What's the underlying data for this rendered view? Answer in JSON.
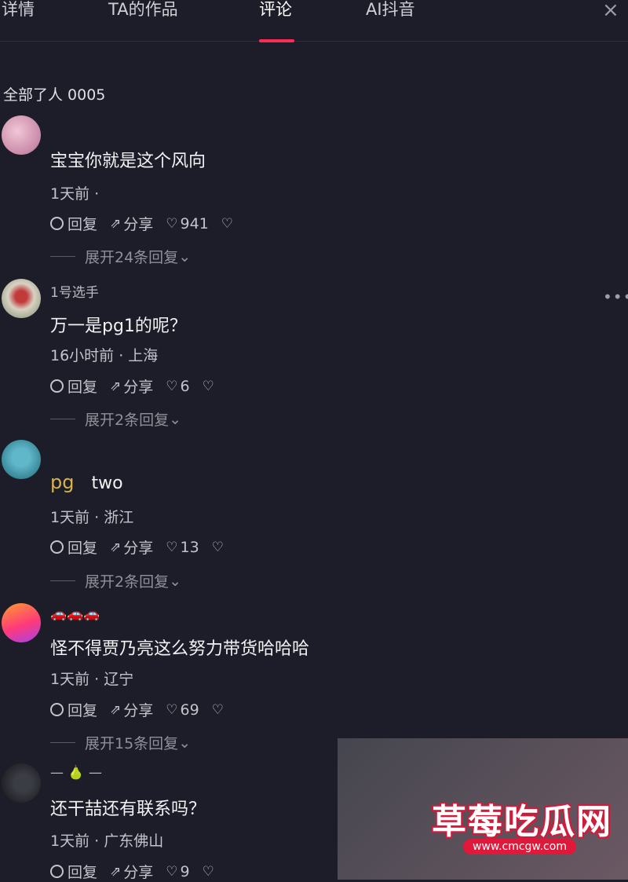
{
  "tabs": [
    "详情",
    "TA的作品",
    "评论",
    "AI抖音"
  ],
  "close_label": "×",
  "comment_count": "全部了人 0005",
  "actions": {
    "reply": "回复",
    "share": "分享"
  },
  "comments": [
    {
      "user": "",
      "text": "宝宝你就是这个风向",
      "meta": "1天前 ·",
      "likes": "941",
      "expand": "展开24条回复"
    },
    {
      "user": "1号选手",
      "text": "万一是pg1的呢？",
      "meta": "16小时前 · 上海",
      "likes": "6",
      "expand": "展开2条回复"
    },
    {
      "user": "",
      "text_prefix": "pg",
      "text": "two",
      "meta": "1天前 · 浙江",
      "likes": "13",
      "expand": "展开2条回复"
    },
    {
      "user": "🚗🚗🚗",
      "text": "怪不得贾乃亮这么努力带货哈哈哈",
      "meta": "1天前 · 辽宁",
      "likes": "69",
      "expand": "展开15条回复"
    },
    {
      "user": "— 🍐 —",
      "text": "还干喆还有联系吗？",
      "meta": "1天前 · 广东佛山",
      "likes": "9",
      "expand": ""
    }
  ],
  "watermark": {
    "title": "草莓吃瓜网",
    "url": "www.cmcgw.com"
  },
  "colors": {
    "background": "#1c1d28",
    "accent": "#fe2c55"
  }
}
